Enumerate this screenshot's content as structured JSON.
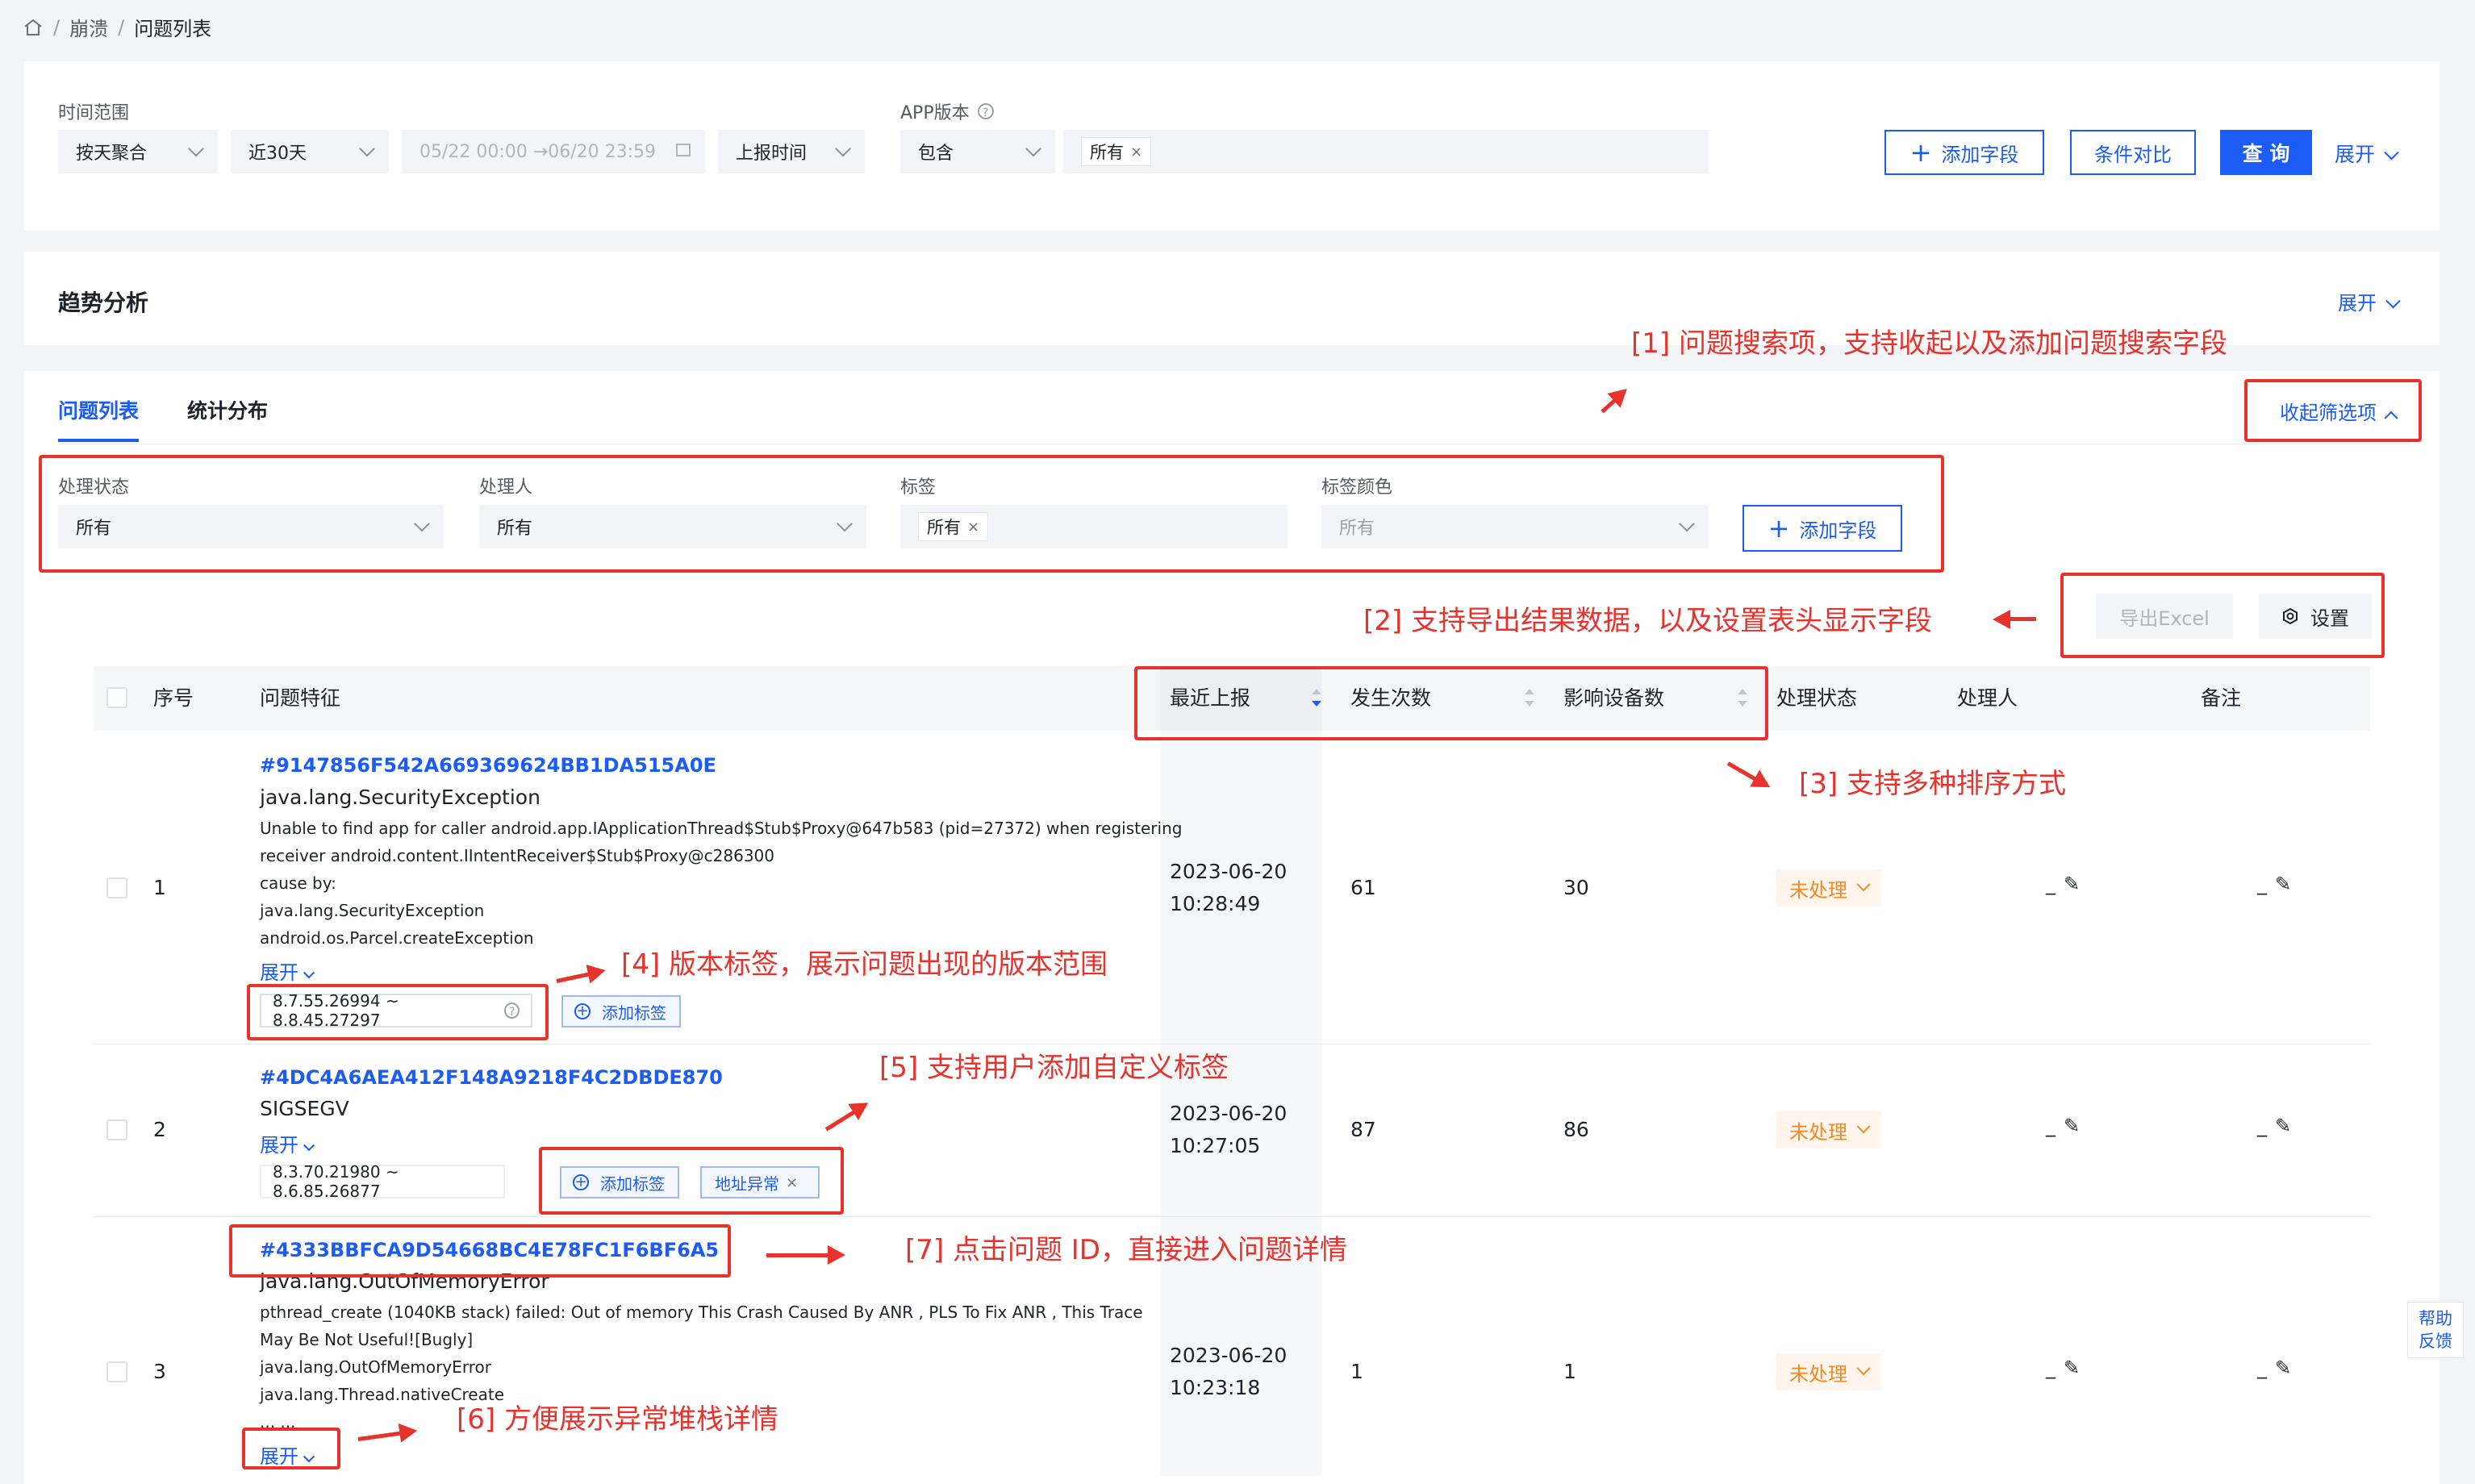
{
  "breadcrumb": {
    "sep": "/",
    "level1": "崩溃",
    "level2": "问题列表"
  },
  "filters": {
    "time_range_label": "时间范围",
    "aggregate": "按天聚合",
    "recent": "近30天",
    "date_range": "05/22 00:00 →06/20 23:59",
    "time_type": "上报时间",
    "app_version_label": "APP版本",
    "include": "包含",
    "version_tag": "所有",
    "add_field": "添加字段",
    "compare": "条件对比",
    "query": "查 询",
    "expand": "展开"
  },
  "trend": {
    "title": "趋势分析",
    "expand": "展开"
  },
  "tabs": {
    "list": "问题列表",
    "stats": "统计分布",
    "collapse": "收起筛选项"
  },
  "sub_filters": {
    "status_label": "处理状态",
    "status_value": "所有",
    "handler_label": "处理人",
    "handler_value": "所有",
    "tag_label": "标签",
    "tag_value": "所有",
    "tag_color_label": "标签颜色",
    "tag_color_value": "所有",
    "add_field": "添加字段"
  },
  "toolbar": {
    "export": "导出Excel",
    "settings": "设置"
  },
  "table": {
    "headers": {
      "index": "序号",
      "feature": "问题特征",
      "last_report": "最近上报",
      "count": "发生次数",
      "devices": "影响设备数",
      "status": "处理状态",
      "handler": "处理人",
      "remark": "备注"
    },
    "rows": [
      {
        "index": "1",
        "id": "#9147856F542A669369624BB1DA515A0E",
        "name": "java.lang.SecurityException",
        "stack": [
          "Unable to find app for caller android.app.IApplicationThread$Stub$Proxy@647b583 (pid=27372) when registering",
          "receiver android.content.IIntentReceiver$Stub$Proxy@c286300",
          "cause by:",
          "java.lang.SecurityException",
          "android.os.Parcel.createException"
        ],
        "expand": "展开",
        "version": "8.7.55.26994 ~ 8.8.45.27297",
        "add_tag": "添加标签",
        "date": "2023-06-20",
        "time": "10:28:49",
        "count": "61",
        "devices": "30",
        "status": "未处理",
        "handler": "_",
        "remark": "_"
      },
      {
        "index": "2",
        "id": "#4DC4A6AEA412F148A9218F4C2DBDE870",
        "name": "SIGSEGV",
        "stack": [],
        "expand": "展开",
        "version": "8.3.70.21980 ~ 8.6.85.26877",
        "add_tag": "添加标签",
        "custom_tag": "地址异常",
        "date": "2023-06-20",
        "time": "10:27:05",
        "count": "87",
        "devices": "86",
        "status": "未处理",
        "handler": "_",
        "remark": "_"
      },
      {
        "index": "3",
        "id": "#4333BBFCA9D54668BC4E78FC1F6BF6A5",
        "name": "java.lang.OutOfMemoryError",
        "stack": [
          "pthread_create (1040KB stack) failed: Out of memory This Crash Caused By ANR , PLS To Fix ANR , This Trace",
          "May Be Not Useful![Bugly]",
          "java.lang.OutOfMemoryError",
          "java.lang.Thread.nativeCreate",
          "... ..."
        ],
        "expand": "展开",
        "date": "2023-06-20",
        "time": "10:23:18",
        "count": "1",
        "devices": "1",
        "status": "未处理",
        "handler": "_",
        "remark": "_"
      }
    ]
  },
  "annotations": {
    "a1": "[1] 问题搜索项，支持收起以及添加问题搜索字段",
    "a2": "[2] 支持导出结果数据，以及设置表头显示字段",
    "a3": "[3] 支持多种排序方式",
    "a4": "[4] 版本标签，展示问题出现的版本范围",
    "a5": "[5] 支持用户添加自定义标签",
    "a6": "[6] 方便展示异常堆栈详情",
    "a7": "[7] 点击问题 ID，直接进入问题详情"
  },
  "help": {
    "line1": "帮助",
    "line2": "反馈"
  },
  "colors": {
    "accent": "#1a5cf5",
    "annotation": "#e8322c",
    "pending": "#f08a24"
  }
}
